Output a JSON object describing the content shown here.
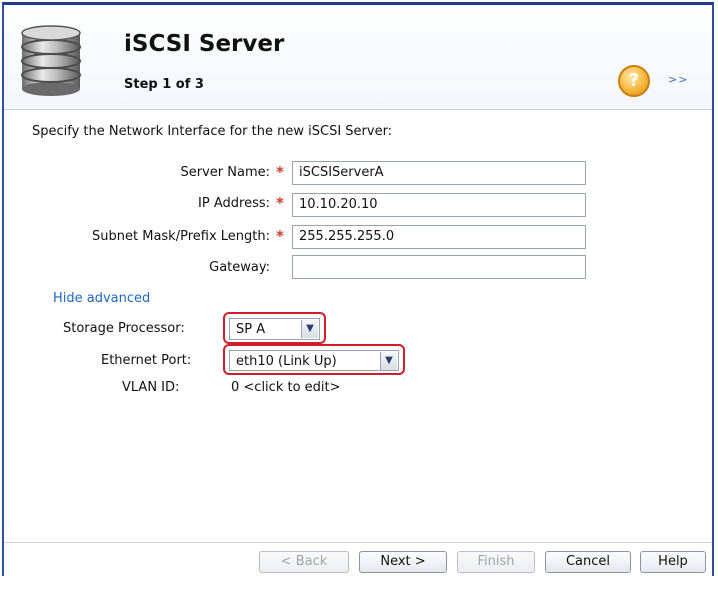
{
  "header": {
    "title": "iSCSI Server",
    "step": "Step 1 of 3",
    "help_glyph": "?",
    "next_arrows": ">>"
  },
  "instruction": "Specify the Network Interface for the new iSCSI Server:",
  "fields": {
    "server_name": {
      "label": "Server Name:",
      "value": "iSCSIServerA",
      "required": true
    },
    "ip_address": {
      "label": "IP Address:",
      "value": "10.10.20.10",
      "required": true
    },
    "subnet": {
      "label": "Subnet Mask/Prefix Length:",
      "value": "255.255.255.0",
      "required": true
    },
    "gateway": {
      "label": "Gateway:",
      "value": "",
      "required": false
    }
  },
  "required_marker": "*",
  "advanced": {
    "toggle_label": "Hide advanced",
    "storage_processor": {
      "label": "Storage Processor:",
      "value": "SP A"
    },
    "ethernet_port": {
      "label": "Ethernet Port:",
      "value": "eth10 (Link Up)"
    },
    "vlan": {
      "label": "VLAN ID:",
      "value": "0 <click to edit>"
    }
  },
  "buttons": {
    "back": "< Back",
    "next": "Next >",
    "finish": "Finish",
    "cancel": "Cancel",
    "help": "Help"
  },
  "colors": {
    "highlight": "#d21e2a",
    "link": "#2167c1",
    "required": "#d23a2a"
  }
}
